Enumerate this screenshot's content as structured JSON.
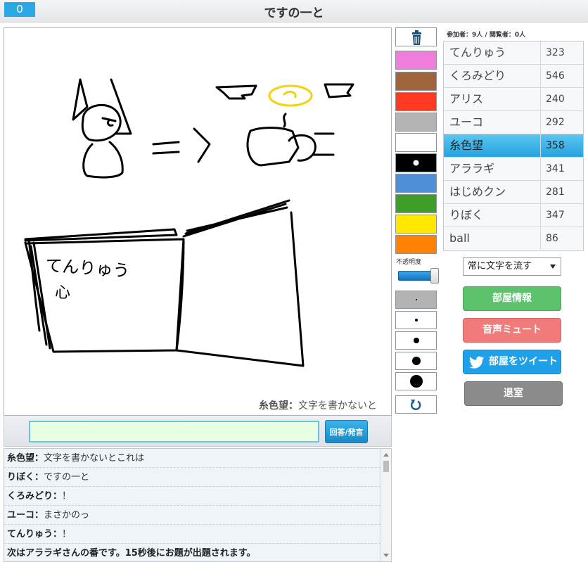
{
  "header": {
    "timer": "0",
    "title": "ですの一と"
  },
  "canvas": {
    "scroll_name": "糸色望：",
    "scroll_text": "文字を書かないと"
  },
  "answer": {
    "input_value": "",
    "button_label": "回答/発言"
  },
  "chat": [
    {
      "name": "糸色望：",
      "text": "文字を書かないとこれは"
    },
    {
      "name": "りぼく：",
      "text": "ですの一と"
    },
    {
      "name": "くろみどり：",
      "text": "！"
    },
    {
      "name": "ユーコ：",
      "text": "まさかのっ"
    },
    {
      "name": "てんりゅう：",
      "text": "！"
    },
    {
      "name": "",
      "text": "次はアララギさんの番です。15秒後にお題が出題されます。"
    }
  ],
  "tools": {
    "trash_icon": "trash-icon",
    "colors": [
      "#f07cdb",
      "#a0653c",
      "#ff3a22",
      "#b4b4b4",
      "#ffffff",
      "#000000",
      "#4f8fd8",
      "#3e9e27",
      "#ffe800",
      "#ff8205"
    ],
    "selected_color_index": 5,
    "opacity_label": "不透明度",
    "opacity_value": 1.0,
    "brush_sizes": [
      2,
      4,
      8,
      12,
      18
    ],
    "selected_size_index": 0,
    "undo_icon": "undo-icon"
  },
  "participants": {
    "count_text": "参加者：9人 / 閲覧者：0人",
    "players": [
      {
        "name": "てんりゅう",
        "score": "323"
      },
      {
        "name": "くろみどり",
        "score": "546"
      },
      {
        "name": "アリス",
        "score": "240"
      },
      {
        "name": "ユーコ",
        "score": "292"
      },
      {
        "name": "糸色望",
        "score": "358"
      },
      {
        "name": "アララギ",
        "score": "341"
      },
      {
        "name": "はじめクン",
        "score": "281"
      },
      {
        "name": "りぼく",
        "score": "347"
      },
      {
        "name": "ball",
        "score": "86"
      }
    ],
    "active_index": 4
  },
  "controls": {
    "mode_select": "常に文字を流す",
    "room_info": "部屋情報",
    "mute": "音声ミュート",
    "tweet": "部屋をツイート",
    "leave": "退室"
  },
  "drawing_text": {
    "line1": "てんりゅう",
    "line2": "心"
  }
}
